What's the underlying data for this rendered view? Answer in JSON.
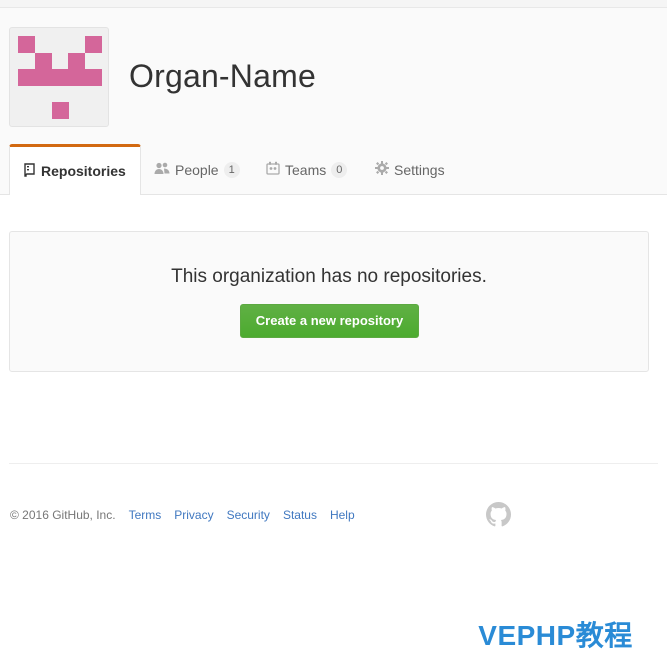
{
  "org": {
    "name": "Organ-Name",
    "avatar_color": "#d4669a"
  },
  "tabs": [
    {
      "label": "Repositories",
      "icon": "repo-icon",
      "active": true
    },
    {
      "label": "People",
      "icon": "people-icon",
      "count": "1"
    },
    {
      "label": "Teams",
      "icon": "teams-icon",
      "count": "0"
    },
    {
      "label": "Settings",
      "icon": "gear-icon"
    }
  ],
  "blankslate": {
    "title": "This organization has no repositories.",
    "button_label": "Create a new repository"
  },
  "footer": {
    "copyright": "© 2016 GitHub, Inc.",
    "links": [
      "Terms",
      "Privacy",
      "Security",
      "Status",
      "Help"
    ]
  },
  "watermark": "VEPHP教程",
  "colors": {
    "tab_accent": "#d26911",
    "button_green": "#55a532",
    "link_blue": "#4078c0"
  }
}
